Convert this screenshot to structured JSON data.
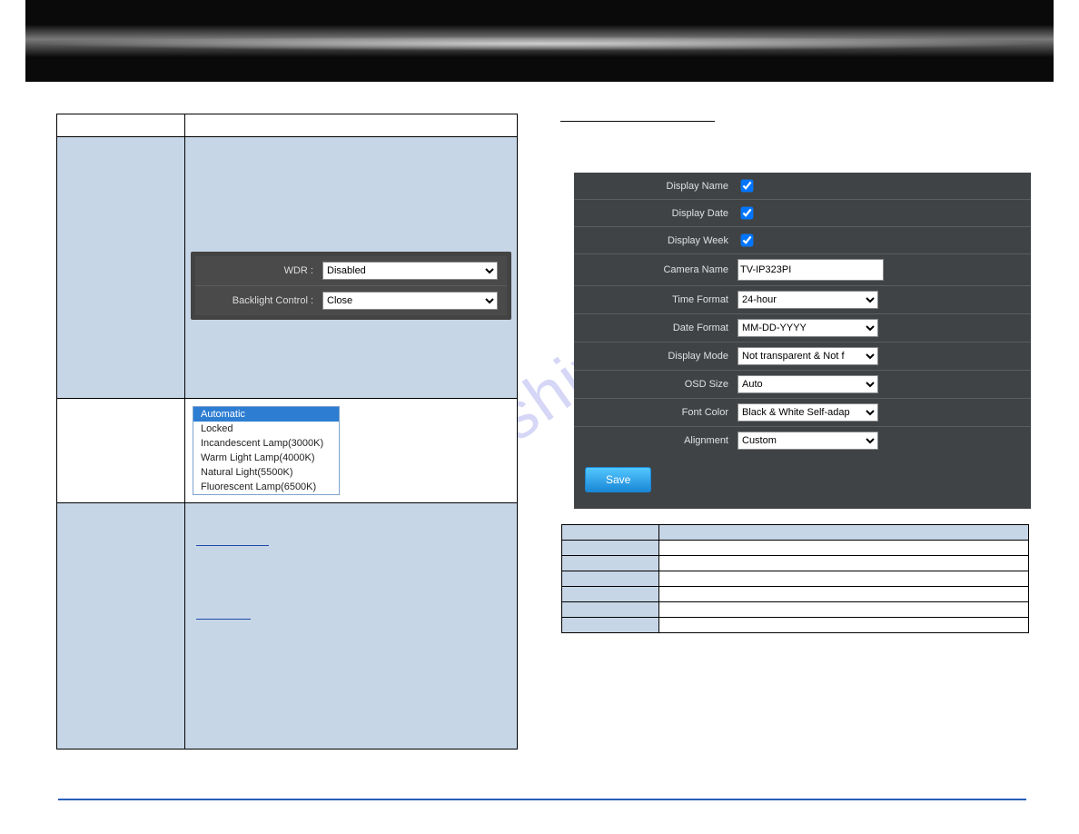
{
  "watermark": "manualshive.com",
  "left_panel": {
    "wdr_label": "WDR :",
    "wdr_value": "Disabled",
    "backlight_label": "Backlight Control :",
    "backlight_value": "Close"
  },
  "wb_list": {
    "items": [
      "Automatic",
      "Locked",
      "Incandescent Lamp(3000K)",
      "Warm Light Lamp(4000K)",
      "Natural Light(5500K)",
      "Fluorescent Lamp(6500K)"
    ],
    "selected_index": 0
  },
  "osd_heading": "",
  "osd": {
    "display_name_label": "Display Name",
    "display_name_checked": true,
    "display_date_label": "Display Date",
    "display_date_checked": true,
    "display_week_label": "Display Week",
    "display_week_checked": true,
    "camera_name_label": "Camera Name",
    "camera_name_value": "TV-IP323PI",
    "time_format_label": "Time Format",
    "time_format_value": "24-hour",
    "date_format_label": "Date Format",
    "date_format_value": "MM-DD-YYYY",
    "display_mode_label": "Display Mode",
    "display_mode_value": "Not transparent & Not f",
    "osd_size_label": "OSD Size",
    "osd_size_value": "Auto",
    "font_color_label": "Font Color",
    "font_color_value": "Black & White Self-adap",
    "alignment_label": "Alignment",
    "alignment_value": "Custom",
    "save_label": "Save"
  },
  "desc_rows": [
    {
      "a": "",
      "b": ""
    },
    {
      "a": "",
      "b": ""
    },
    {
      "a": "",
      "b": ""
    },
    {
      "a": "",
      "b": ""
    },
    {
      "a": "",
      "b": ""
    },
    {
      "a": "",
      "b": ""
    },
    {
      "a": "",
      "b": ""
    }
  ]
}
